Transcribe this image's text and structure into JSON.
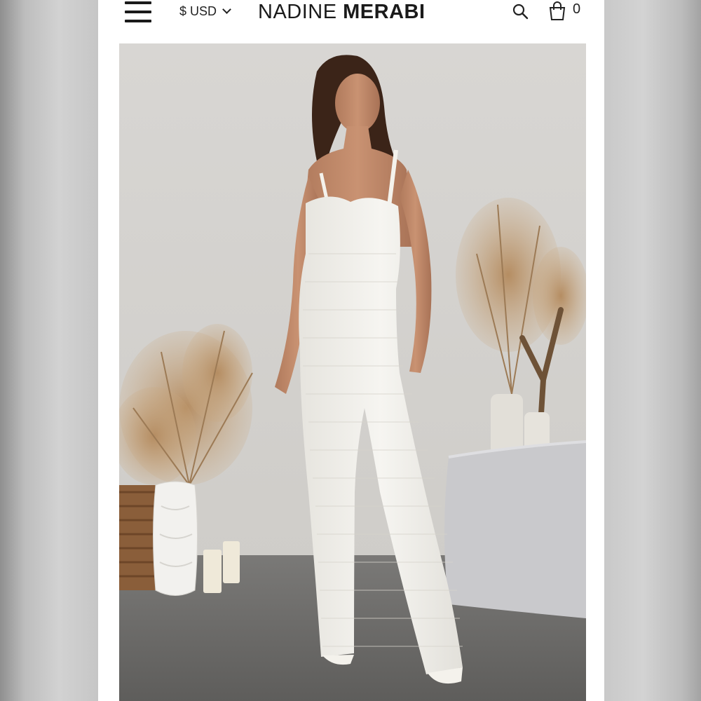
{
  "header": {
    "menu_icon": "hamburger-menu-icon",
    "currency_label": "$ USD",
    "brand_first": "NADINE ",
    "brand_second": "MERABI",
    "search_icon": "search-icon",
    "cart_icon": "shopping-bag-icon",
    "cart_count": "0"
  },
  "product": {
    "image_alt": "Model wearing white sequin flared jumpsuit with pampas grass decor"
  },
  "colors": {
    "brand_text": "#1a1a1a",
    "garment": "#f1efe9",
    "backdrop": "#d6d4d1",
    "floor": "#6a6967"
  }
}
